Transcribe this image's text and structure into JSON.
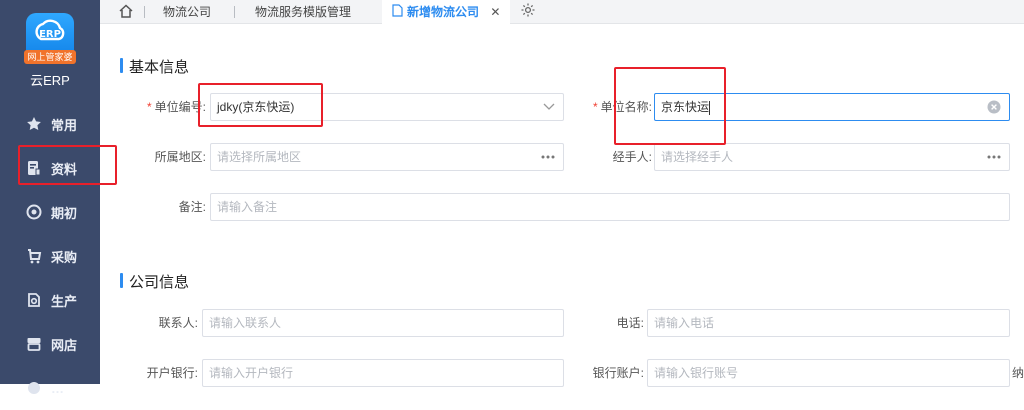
{
  "sidebar": {
    "logo_text": "ERP",
    "logo_ribbon": "网上管家婆",
    "brand": "云ERP",
    "items": [
      {
        "label": "常用",
        "icon": "star-icon"
      },
      {
        "label": "资料",
        "icon": "document-icon"
      },
      {
        "label": "期初",
        "icon": "target-icon"
      },
      {
        "label": "采购",
        "icon": "cart-icon"
      },
      {
        "label": "生产",
        "icon": "production-icon"
      },
      {
        "label": "网店",
        "icon": "store-icon"
      },
      {
        "label": "…",
        "icon": "more-icon"
      }
    ]
  },
  "tabs": {
    "home": "home-icon",
    "items": [
      {
        "label": "物流公司"
      },
      {
        "label": "物流服务模版管理"
      },
      {
        "label": "新增物流公司",
        "active": true
      }
    ],
    "close": "✕",
    "settings": "gear-icon"
  },
  "basic": {
    "title": "基本信息",
    "unit_code": {
      "label": "单位编号:",
      "value": "jdky(京东快运)"
    },
    "unit_name": {
      "label": "单位名称:",
      "value": "京东快运"
    },
    "region": {
      "label": "所属地区:",
      "placeholder": "请选择所属地区"
    },
    "handler": {
      "label": "经手人:",
      "placeholder": "请选择经手人"
    },
    "remark": {
      "label": "备注:",
      "placeholder": "请输入备注"
    }
  },
  "company": {
    "title": "公司信息",
    "contact": {
      "label": "联系人:",
      "placeholder": "请输入联系人"
    },
    "phone": {
      "label": "电话:",
      "placeholder": "请输入电话"
    },
    "bank": {
      "label": "开户银行:",
      "placeholder": "请输入开户银行"
    },
    "account": {
      "label": "银行账户:",
      "placeholder": "请输入银行账号"
    },
    "tax_label_partial": "纳"
  },
  "colors": {
    "accent": "#2d8cf0",
    "sidebar": "#3b4a6b",
    "highlight": "#e8202a",
    "required": "#f04134"
  }
}
